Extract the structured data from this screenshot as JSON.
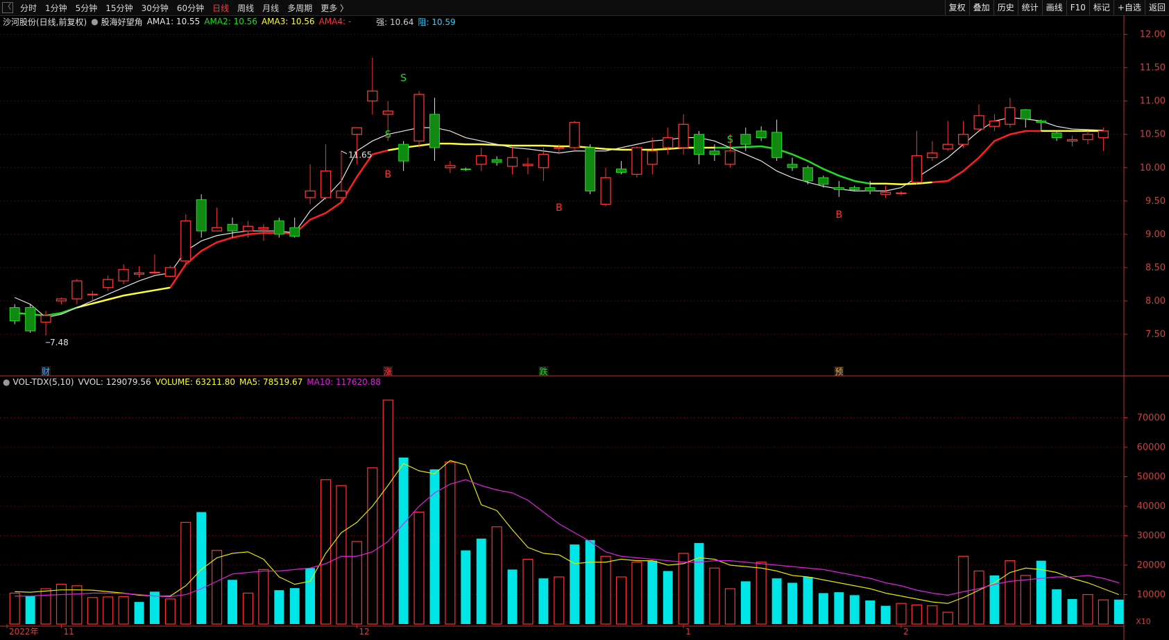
{
  "toolbar": {
    "left_items": [
      {
        "label": "分时",
        "active": false
      },
      {
        "label": "1分钟",
        "active": false
      },
      {
        "label": "5分钟",
        "active": false
      },
      {
        "label": "15分钟",
        "active": false
      },
      {
        "label": "30分钟",
        "active": false
      },
      {
        "label": "60分钟",
        "active": false
      },
      {
        "label": "日线",
        "active": true
      },
      {
        "label": "周线",
        "active": false
      },
      {
        "label": "月线",
        "active": false
      },
      {
        "label": "多周期",
        "active": false
      },
      {
        "label": "更多 〉",
        "active": false
      }
    ],
    "right_items": [
      "复权",
      "叠加",
      "历史",
      "统计",
      "画线",
      "F10",
      "标记",
      "+自选",
      "返回"
    ]
  },
  "price_header": {
    "stock": "沙河股份(日线,前复权)",
    "indicator": "股海好望角",
    "ama1": "AMA1: 10.55",
    "ama2": "AMA2: 10.56",
    "ama3": "AMA3: 10.56",
    "ama4": "AMA4: -",
    "strong": "强: 10.64",
    "resist": "阻: 10.59"
  },
  "volume_header": {
    "name": "VOL-TDX(5,10)",
    "vvol": "VVOL: 129079.56",
    "volume": "VOLUME: 63211.80",
    "ma5": "MA5: 78519.67",
    "ma10": "MA10: 117620.88"
  },
  "colors": {
    "up": "#ff3333",
    "down": "#00e5e5",
    "ama_red": "#ff2020",
    "ama_white": "#e8e8e8",
    "ama_green": "#22dd22",
    "ama_yellow": "#ffff33",
    "ma5": "#e6e600",
    "ma10": "#e020e0",
    "grid": "#5a0000",
    "axis": "#c03030"
  },
  "chart_data": [
    {
      "type": "candlestick",
      "title": "沙河股份(日线,前复权)",
      "ylim": [
        7.0,
        12.1
      ],
      "y_ticks": [
        "12.00",
        "11.50",
        "11.00",
        "10.50",
        "10.00",
        "9.50",
        "9.00",
        "8.50",
        "8.00",
        "7.50"
      ],
      "x_labels": [
        {
          "index": 0,
          "label": "2022年"
        },
        {
          "index": 3,
          "label": "11"
        },
        {
          "index": 22,
          "label": "12"
        },
        {
          "index": 43,
          "label": "1"
        },
        {
          "index": 57,
          "label": "2"
        }
      ],
      "annotations": {
        "high": {
          "index": 21,
          "label": "11.65"
        },
        "low": {
          "index": 2,
          "label": "7.48"
        },
        "signals": [
          {
            "index": 24,
            "label": "S",
            "kind": "sell",
            "price": 10.45
          },
          {
            "index": 25,
            "label": "S",
            "kind": "sell",
            "price": 11.3
          },
          {
            "index": 24,
            "label": "B",
            "kind": "buy",
            "price": 9.85
          },
          {
            "index": 35,
            "label": "B",
            "kind": "buy",
            "price": 9.35
          },
          {
            "index": 46,
            "label": "S",
            "kind": "sell",
            "price": 10.37
          },
          {
            "index": 53,
            "label": "B",
            "kind": "buy",
            "price": 9.25
          }
        ],
        "events": [
          {
            "index": 2,
            "label": "财",
            "color": "#4aa8ff"
          },
          {
            "index": 24,
            "label": "涨",
            "color": "#ff4040"
          },
          {
            "index": 34,
            "label": "跌",
            "color": "#22dd22"
          },
          {
            "index": 53,
            "label": "预",
            "color": "#ffaa40"
          }
        ]
      },
      "candles": [
        [
          7.9,
          7.7,
          7.95,
          7.65
        ],
        [
          7.9,
          7.55,
          7.95,
          7.52
        ],
        [
          7.68,
          7.78,
          7.85,
          7.48
        ],
        [
          8.0,
          8.03,
          8.05,
          7.95
        ],
        [
          8.03,
          8.3,
          8.33,
          7.95
        ],
        [
          8.1,
          8.1,
          8.15,
          8.0
        ],
        [
          8.2,
          8.32,
          8.38,
          8.15
        ],
        [
          8.3,
          8.47,
          8.55,
          8.25
        ],
        [
          8.4,
          8.42,
          8.52,
          8.35
        ],
        [
          8.42,
          8.43,
          8.7,
          8.4
        ],
        [
          8.37,
          8.5,
          8.53,
          8.35
        ],
        [
          8.6,
          9.2,
          9.3,
          8.55
        ],
        [
          9.52,
          9.05,
          9.6,
          8.95
        ],
        [
          9.05,
          9.1,
          9.4,
          9.05
        ],
        [
          9.15,
          9.05,
          9.25,
          8.95
        ],
        [
          9.05,
          9.12,
          9.2,
          8.95
        ],
        [
          9.08,
          9.1,
          9.15,
          8.9
        ],
        [
          9.2,
          9.0,
          9.25,
          8.95
        ],
        [
          9.1,
          8.97,
          9.25,
          8.95
        ],
        [
          9.55,
          9.65,
          10.05,
          9.45
        ],
        [
          9.55,
          9.95,
          10.35,
          9.52
        ],
        [
          9.55,
          9.65,
          10.25,
          9.5
        ],
        [
          10.5,
          10.6,
          10.6,
          10.05
        ],
        [
          11.0,
          11.15,
          11.65,
          10.8
        ],
        [
          10.8,
          10.85,
          11.0,
          10.4
        ],
        [
          10.35,
          10.1,
          10.4,
          9.95
        ],
        [
          10.4,
          11.1,
          11.15,
          10.3
        ],
        [
          10.8,
          10.3,
          11.05,
          10.1
        ],
        [
          10.0,
          10.03,
          10.1,
          9.92
        ],
        [
          9.98,
          9.97,
          10.0,
          9.95
        ],
        [
          10.05,
          10.18,
          10.3,
          9.95
        ],
        [
          10.12,
          10.08,
          10.17,
          10.03
        ],
        [
          10.02,
          10.15,
          10.3,
          9.9
        ],
        [
          10.03,
          10.05,
          10.15,
          9.9
        ],
        [
          10.0,
          10.2,
          10.3,
          9.8
        ],
        [
          10.3,
          10.3,
          10.35,
          10.2
        ],
        [
          10.3,
          10.68,
          10.7,
          10.25
        ],
        [
          10.3,
          9.65,
          10.35,
          9.6
        ],
        [
          9.45,
          9.85,
          10.0,
          9.42
        ],
        [
          9.98,
          9.93,
          10.1,
          9.9
        ],
        [
          9.9,
          10.3,
          10.32,
          9.85
        ],
        [
          10.05,
          10.25,
          10.45,
          9.9
        ],
        [
          10.3,
          10.45,
          10.6,
          10.2
        ],
        [
          10.3,
          10.65,
          10.8,
          10.2
        ],
        [
          10.5,
          10.2,
          10.55,
          10.05
        ],
        [
          10.25,
          10.2,
          10.35,
          10.1
        ],
        [
          10.05,
          10.25,
          10.5,
          10.0
        ],
        [
          10.5,
          10.35,
          10.6,
          10.25
        ],
        [
          10.55,
          10.45,
          10.62,
          10.4
        ],
        [
          10.53,
          10.15,
          10.72,
          10.1
        ],
        [
          10.05,
          10.0,
          10.15,
          9.95
        ],
        [
          10.0,
          9.8,
          10.03,
          9.75
        ],
        [
          9.85,
          9.75,
          9.88,
          9.7
        ],
        [
          9.7,
          9.67,
          9.8,
          9.56
        ],
        [
          9.7,
          9.67,
          9.73,
          9.65
        ],
        [
          9.7,
          9.65,
          9.8,
          9.6
        ],
        [
          9.6,
          9.63,
          9.73,
          9.55
        ],
        [
          9.62,
          9.62,
          9.65,
          9.58
        ],
        [
          9.78,
          10.18,
          10.55,
          9.75
        ],
        [
          10.15,
          10.22,
          10.4,
          10.1
        ],
        [
          10.28,
          10.35,
          10.7,
          10.25
        ],
        [
          10.35,
          10.5,
          10.7,
          10.3
        ],
        [
          10.58,
          10.78,
          10.95,
          10.55
        ],
        [
          10.62,
          10.7,
          10.8,
          10.55
        ],
        [
          10.65,
          10.9,
          11.05,
          10.6
        ],
        [
          10.87,
          10.73,
          10.88,
          10.6
        ],
        [
          10.7,
          10.68,
          10.72,
          10.55
        ],
        [
          10.52,
          10.45,
          10.55,
          10.4
        ],
        [
          10.4,
          10.42,
          10.48,
          10.32
        ],
        [
          10.42,
          10.5,
          10.55,
          10.35
        ],
        [
          10.45,
          10.55,
          10.6,
          10.25
        ]
      ],
      "ama_line": [
        7.82,
        7.8,
        7.78,
        7.82,
        7.9,
        7.96,
        8.02,
        8.08,
        8.12,
        8.16,
        8.2,
        8.55,
        8.75,
        8.88,
        8.95,
        9.0,
        9.02,
        9.02,
        9.01,
        9.22,
        9.32,
        9.48,
        9.86,
        10.2,
        10.26,
        10.3,
        10.33,
        10.36,
        10.36,
        10.35,
        10.35,
        10.34,
        10.33,
        10.33,
        10.33,
        10.32,
        10.32,
        10.3,
        10.28,
        10.27,
        10.27,
        10.27,
        10.28,
        10.3,
        10.3,
        10.3,
        10.3,
        10.31,
        10.32,
        10.28,
        10.2,
        10.1,
        9.98,
        9.88,
        9.8,
        9.76,
        9.76,
        9.75,
        9.76,
        9.78,
        9.8,
        9.95,
        10.15,
        10.4,
        10.5,
        10.55,
        10.55,
        10.55,
        10.55,
        10.55,
        10.55,
        10.55
      ],
      "ama_color_segments": [
        {
          "from": 0,
          "to": 4,
          "color": "green"
        },
        {
          "from": 4,
          "to": 10,
          "color": "yellow"
        },
        {
          "from": 10,
          "to": 24,
          "color": "red"
        },
        {
          "from": 24,
          "to": 45,
          "color": "yellow"
        },
        {
          "from": 45,
          "to": 55,
          "color": "green"
        },
        {
          "from": 55,
          "to": 59,
          "color": "yellow"
        },
        {
          "from": 59,
          "to": 66,
          "color": "red"
        },
        {
          "from": 66,
          "to": 70,
          "color": "yellow"
        }
      ],
      "white_line": [
        8.05,
        7.95,
        7.75,
        7.8,
        7.9,
        8.0,
        8.1,
        8.2,
        8.3,
        8.38,
        8.42,
        8.75,
        8.9,
        8.98,
        9.02,
        9.05,
        9.05,
        9.05,
        9.02,
        9.35,
        9.55,
        9.8,
        10.25,
        10.4,
        10.5,
        10.55,
        10.6,
        10.6,
        10.55,
        10.45,
        10.4,
        10.35,
        10.3,
        10.28,
        10.25,
        10.22,
        10.25,
        10.25,
        10.25,
        10.3,
        10.35,
        10.4,
        10.42,
        10.45,
        10.45,
        10.4,
        10.3,
        10.2,
        10.1,
        9.95,
        9.85,
        9.78,
        9.72,
        9.68,
        9.65,
        9.65,
        9.65,
        9.7,
        9.85,
        10.0,
        10.15,
        10.35,
        10.55,
        10.7,
        10.75,
        10.73,
        10.7,
        10.62,
        10.58,
        10.57,
        10.56
      ]
    },
    {
      "type": "bar",
      "title": "VOL-TDX(5,10)",
      "ylim": [
        0,
        80000
      ],
      "y_ticks": [
        "70000",
        "60000",
        "50000",
        "40000",
        "30000",
        "20000",
        "10000"
      ],
      "unit_label": "X10",
      "volumes": [
        10500,
        9500,
        12000,
        13500,
        13000,
        9000,
        9200,
        9300,
        7500,
        11000,
        8500,
        34500,
        38000,
        25000,
        15000,
        10500,
        18500,
        11500,
        12200,
        19000,
        49000,
        47000,
        28000,
        53000,
        76000,
        56500,
        38000,
        52500,
        55000,
        25000,
        29000,
        33000,
        18500,
        22000,
        15500,
        16000,
        27000,
        28500,
        23000,
        16000,
        21000,
        21500,
        18000,
        24000,
        27500,
        19000,
        12000,
        14500,
        21000,
        15500,
        14000,
        16000,
        10500,
        10800,
        9800,
        8000,
        6200,
        7000,
        6500,
        6200,
        4000,
        23000,
        18000,
        16500,
        21500,
        16500,
        21500,
        11800,
        8500,
        10000,
        8200,
        8300,
        7500,
        6500
      ],
      "ma5": [
        11000,
        10800,
        11200,
        11600,
        11600,
        11500,
        11000,
        10500,
        9800,
        9500,
        9500,
        13000,
        18500,
        22500,
        24000,
        24500,
        22000,
        16000,
        13500,
        14500,
        24000,
        31000,
        34500,
        40000,
        47000,
        54500,
        52000,
        51000,
        55500,
        54000,
        40500,
        38500,
        32000,
        26000,
        24000,
        23500,
        20500,
        21000,
        21000,
        22000,
        21500,
        21500,
        20000,
        20500,
        22500,
        22000,
        20000,
        19500,
        19000,
        18000,
        16500,
        16000,
        15000,
        14000,
        13000,
        12000,
        10500,
        9500,
        8500,
        7500,
        7000,
        9000,
        11500,
        14000,
        17500,
        19000,
        18500,
        17500,
        15500,
        14000,
        12000,
        10000,
        9000,
        8500
      ],
      "ma10": [
        9500,
        9500,
        9800,
        10000,
        10200,
        10500,
        10500,
        10400,
        10000,
        9500,
        9300,
        10000,
        12000,
        14500,
        17000,
        17500,
        18000,
        18000,
        18500,
        19000,
        20500,
        23000,
        23000,
        24500,
        28000,
        34000,
        40000,
        44500,
        47500,
        49000,
        47000,
        45500,
        44500,
        42000,
        38000,
        34000,
        31000,
        28000,
        24500,
        23000,
        22500,
        22000,
        21500,
        21000,
        21000,
        21500,
        21500,
        21000,
        20500,
        20000,
        19500,
        19000,
        18500,
        17500,
        16500,
        15500,
        14000,
        13000,
        11500,
        10500,
        9800,
        11000,
        12000,
        13500,
        14500,
        15000,
        15500,
        16000,
        16000,
        16500,
        15500,
        14000,
        12500,
        11800
      ],
      "up_days": [
        true,
        false,
        true,
        true,
        true,
        true,
        true,
        true,
        false,
        false,
        true,
        true,
        false,
        true,
        false,
        true,
        true,
        false,
        false,
        false,
        true,
        true,
        true,
        true,
        true,
        false,
        true,
        false,
        true,
        false,
        false,
        true,
        false,
        true,
        false,
        true,
        false,
        false,
        true,
        true,
        true,
        false,
        false,
        true,
        false,
        true,
        true,
        false,
        true,
        false,
        false,
        false,
        false,
        false,
        false,
        false,
        false,
        true,
        true,
        true,
        true,
        true,
        true,
        false,
        true,
        true,
        false,
        false,
        false,
        true,
        true,
        false,
        true,
        true
      ]
    }
  ]
}
